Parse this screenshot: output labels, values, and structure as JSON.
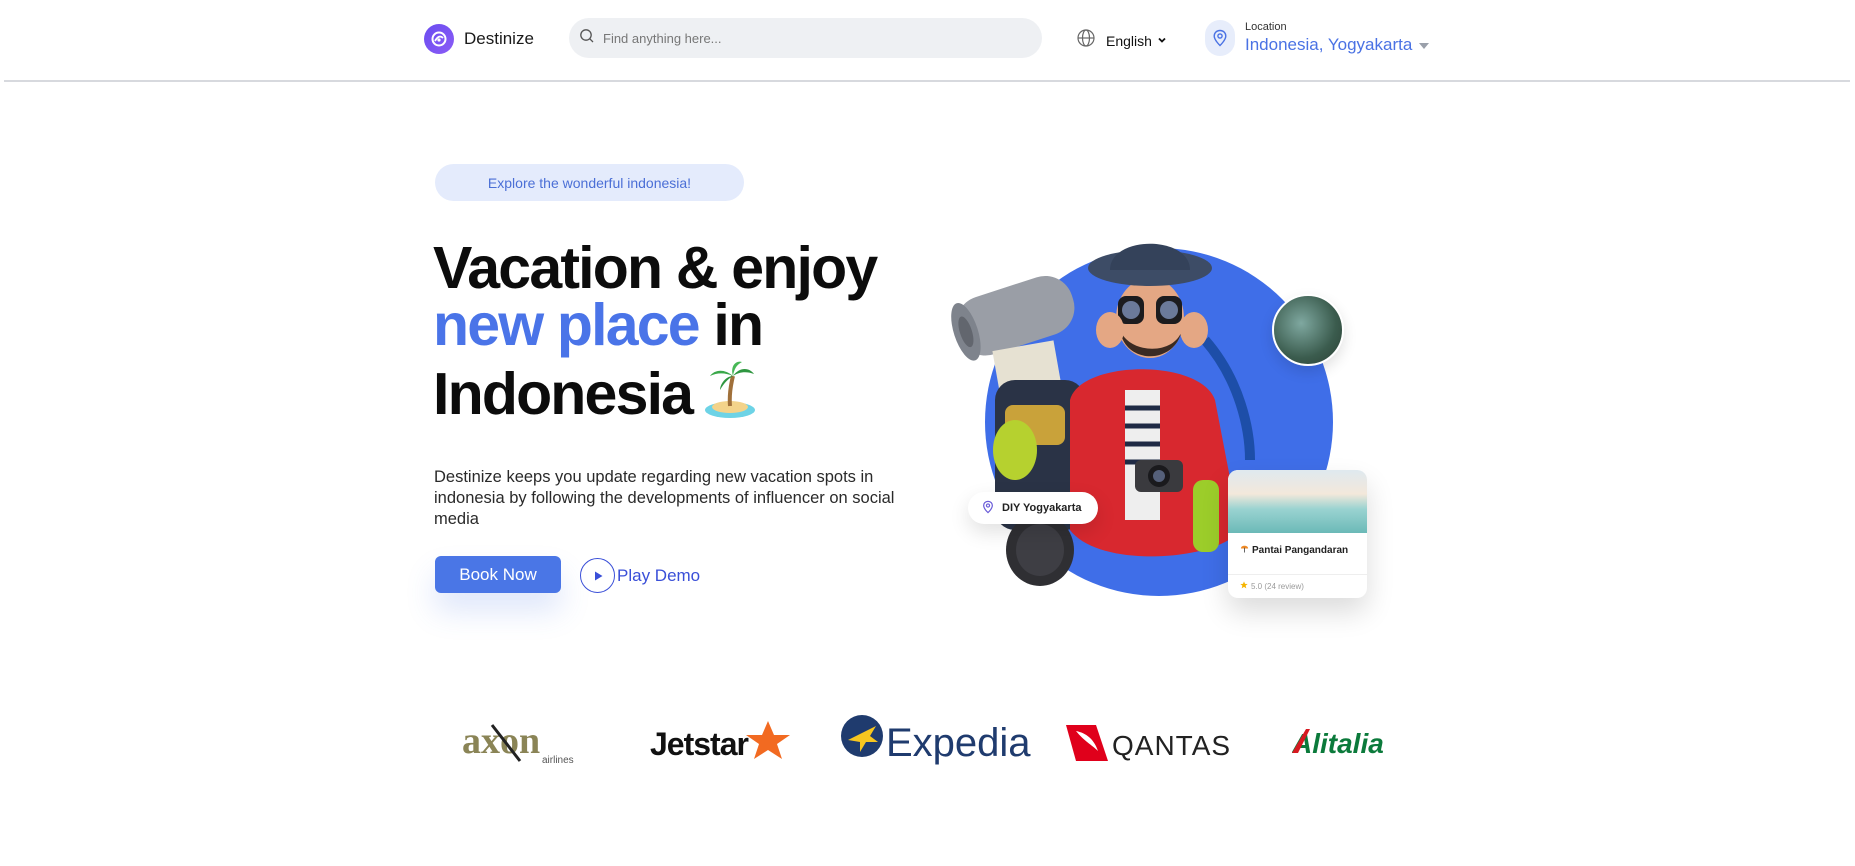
{
  "header": {
    "brand_name": "Destinize",
    "search_placeholder": "Find anything here...",
    "language": "English",
    "location_caption": "Location",
    "location_value": "Indonesia, Yogyakarta"
  },
  "hero": {
    "pill": "Explore the wonderful indonesia!",
    "headline_line1": "Vacation & enjoy",
    "headline_blue": "new place",
    "headline_in": " in",
    "headline_line3": "Indonesia",
    "description": "Destinize keeps you update regarding new vacation spots in indonesia by following the developments of influencer on social media",
    "book_label": "Book Now",
    "demo_label": "Play Demo"
  },
  "illustration": {
    "diy_label": "DIY Yogyakarta",
    "place_name": "Pantai Pangandaran",
    "place_rating": "5.0 (24 review)"
  },
  "partners": {
    "axon": "axon",
    "axon_sub": "airlines",
    "jetstar": "Jetstar",
    "expedia": "Expedia",
    "qantas": "QANTAS",
    "alitalia": "Alitalia"
  },
  "colors": {
    "accent": "#4a74e8",
    "button": "#4a76e6",
    "pill_bg": "#e4ebfc"
  }
}
